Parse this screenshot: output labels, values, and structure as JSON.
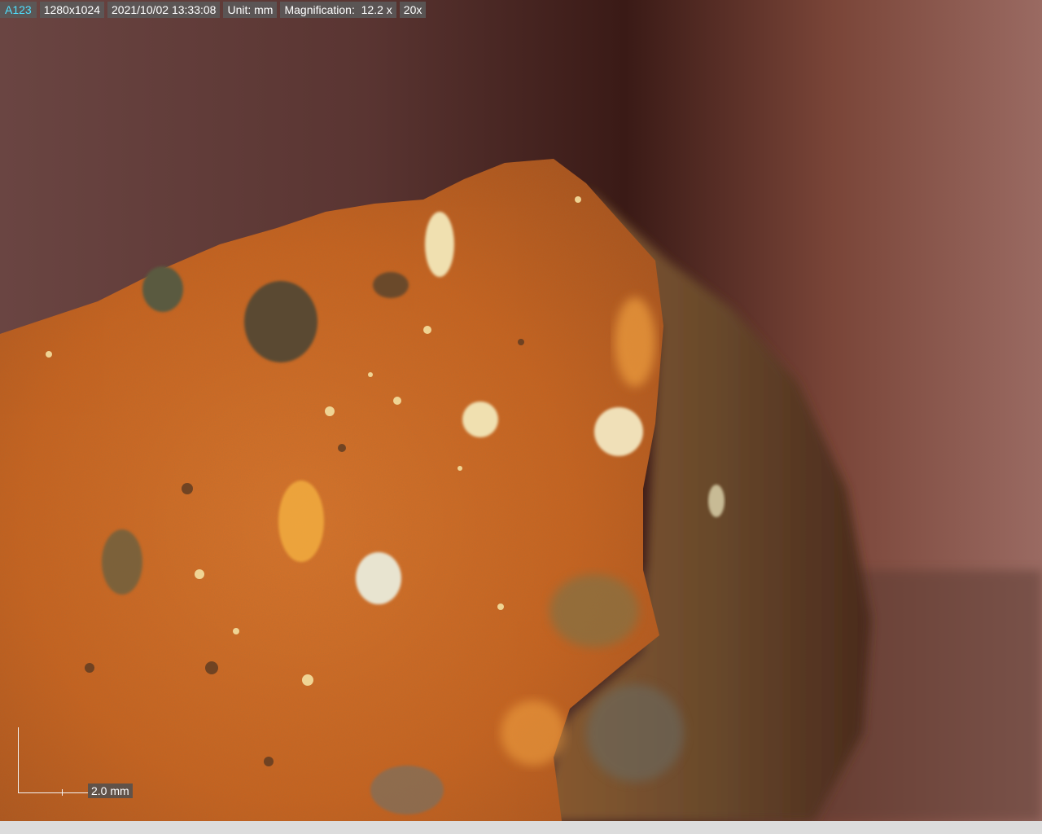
{
  "overlay": {
    "id": "A123",
    "resolution": "1280x1024",
    "timestamp": "2021/10/02 13:33:08",
    "unit": "Unit: mm",
    "magnification_label": "Magnification:",
    "magnification_value": "12.2 x",
    "objective": "20x"
  },
  "scale_bar": {
    "label": "2.0 mm"
  },
  "colors": {
    "id_text": "#4fe0ff",
    "overlay_bg": "#5a5a5a",
    "specimen_orange": "#d2691e",
    "background_brown": "#5a3530"
  }
}
